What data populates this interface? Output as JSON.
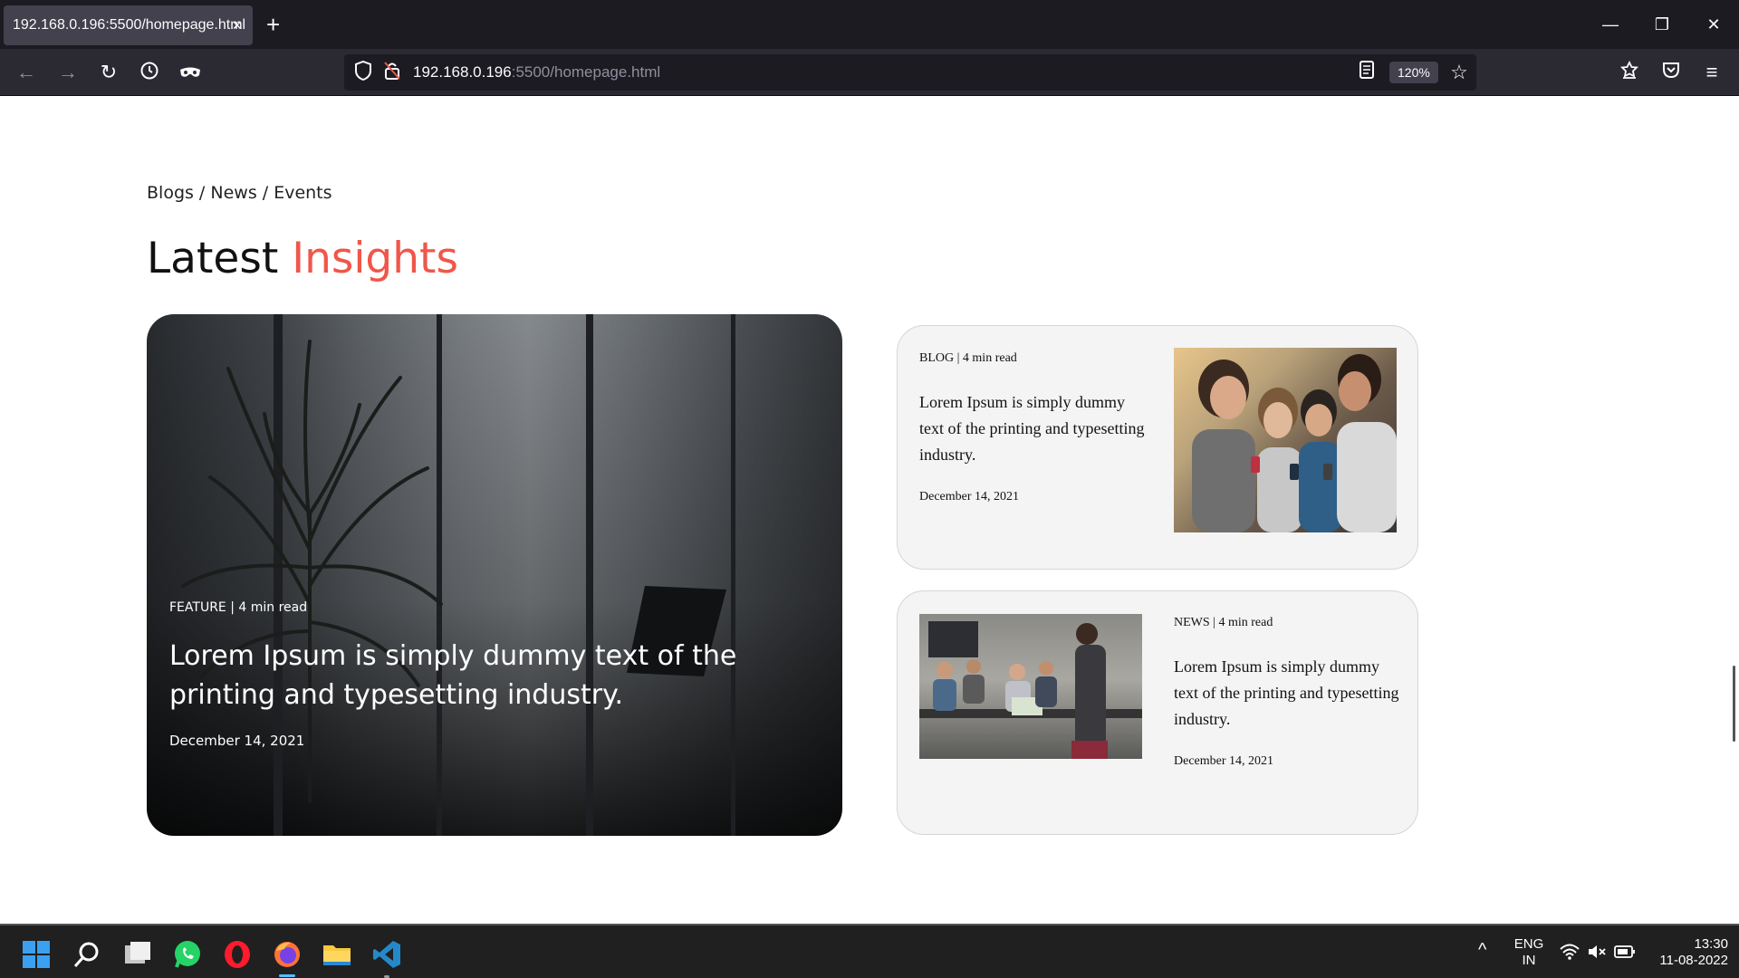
{
  "browser": {
    "tab_title": "192.168.0.196:5500/homepage.html",
    "tab_close": "×",
    "new_tab": "+",
    "window": {
      "minimize": "—",
      "restore": "❐",
      "close": "✕"
    },
    "url_host": "192.168.0.196",
    "url_path": ":5500/homepage.html",
    "zoom": "120%"
  },
  "page": {
    "breadcrumb": "Blogs / News / Events",
    "heading_main": "Latest",
    "heading_accent": "Insights",
    "accent_color": "#f0564a",
    "feature": {
      "meta": "FEATURE | 4 min read",
      "title": "Lorem Ipsum is simply dummy text of the printing and typesetting industry.",
      "date": "December 14, 2021"
    },
    "cards": [
      {
        "meta": "BLOG | 4 min read",
        "title": "Lorem Ipsum is simply dummy text of the printing and typesetting industry.",
        "date": "December 14, 2021",
        "image": "kids-with-phones-image"
      },
      {
        "meta": "NEWS | 4 min read",
        "title": "Lorem Ipsum is simply dummy text of the printing and typesetting industry.",
        "date": "December 14, 2021",
        "image": "classroom-image"
      }
    ]
  },
  "taskbar": {
    "language_line1": "ENG",
    "language_line2": "IN",
    "time": "13:30",
    "date": "11-08-2022"
  }
}
